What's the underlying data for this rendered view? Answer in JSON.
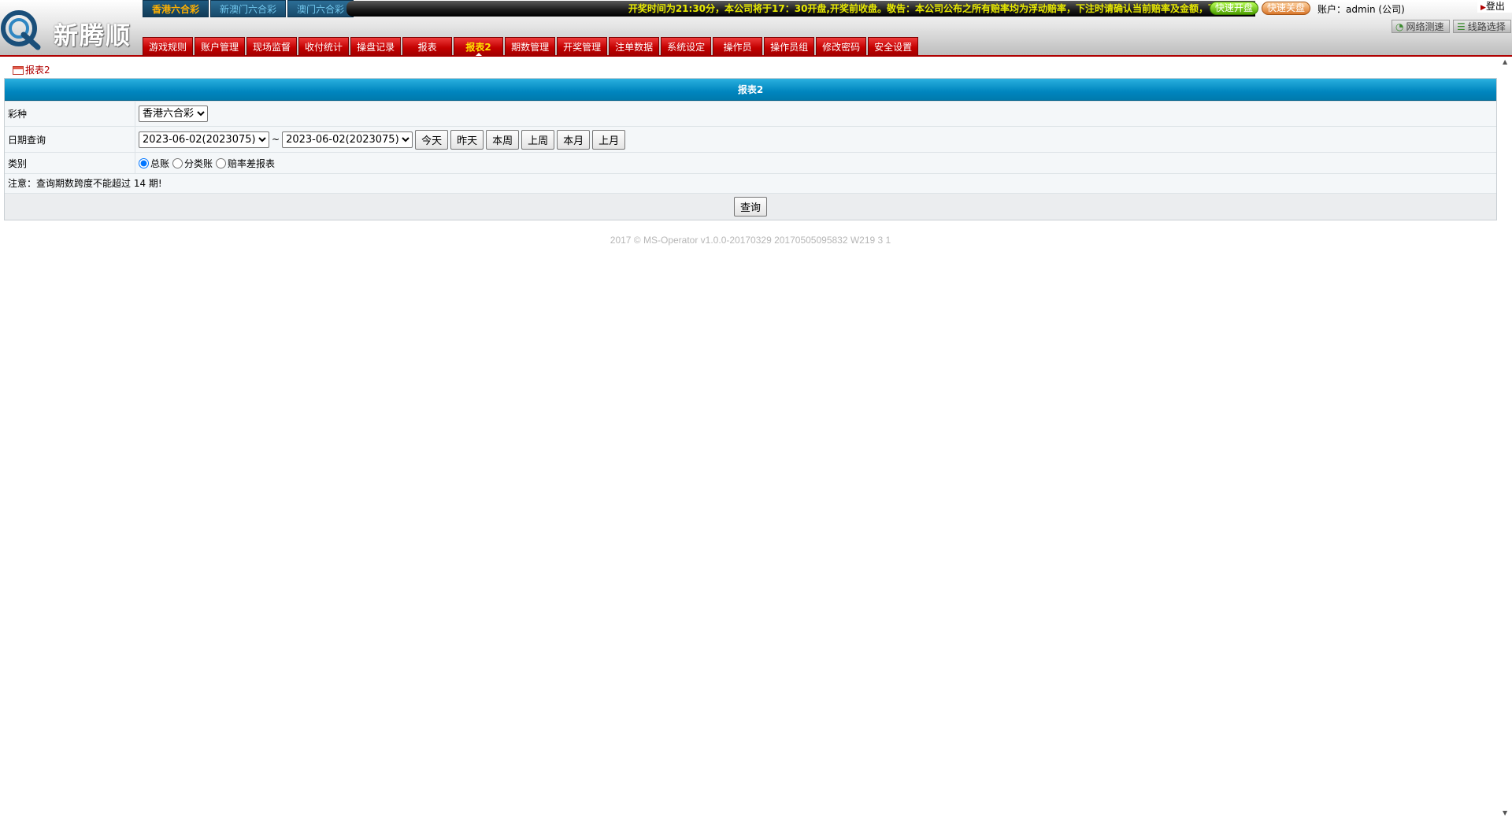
{
  "brand": {
    "name": "新腾顺",
    "logo_icon": "q-logo-icon"
  },
  "lottery_tabs": [
    {
      "label": "香港六合彩",
      "active": true
    },
    {
      "label": "新澳门六合彩",
      "active": false
    },
    {
      "label": "澳门六合彩",
      "active": false
    }
  ],
  "ticker": {
    "text": "开奖时间为21:30分，本公司将于17：30开盘,开奖前收盘。敬告：本公司公布之所有赔率均为浮动赔率，下注时请确认当前赔率及金额，下注确认后"
  },
  "header": {
    "quick_open": "快速开盘",
    "quick_close": "快速关盘",
    "account": "账户：admin (公司)",
    "logout": "登出",
    "speed_test": "网络测速",
    "route_select": "线路选择"
  },
  "nav": [
    {
      "label": "游戏规则",
      "active": false
    },
    {
      "label": "账户管理",
      "active": false
    },
    {
      "label": "现场监督",
      "active": false
    },
    {
      "label": "收付统计",
      "active": false
    },
    {
      "label": "操盘记录",
      "active": false
    },
    {
      "label": "报表",
      "active": false
    },
    {
      "label": "报表2",
      "active": true
    },
    {
      "label": "期数管理",
      "active": false
    },
    {
      "label": "开奖管理",
      "active": false
    },
    {
      "label": "注单数据",
      "active": false
    },
    {
      "label": "系统设定",
      "active": false
    },
    {
      "label": "操作员",
      "active": false
    },
    {
      "label": "操作员组",
      "active": false
    },
    {
      "label": "修改密码",
      "active": false
    },
    {
      "label": "安全设置",
      "active": false
    }
  ],
  "breadcrumb": {
    "label": "报表2"
  },
  "form": {
    "title": "报表2",
    "lottery_label": "彩种",
    "lottery_value": "香港六合彩",
    "date_label": "日期查询",
    "date_from": "2023-06-02(2023075)",
    "date_separator": "~",
    "date_to": "2023-06-02(2023075)",
    "quick_dates": [
      "今天",
      "昨天",
      "本周",
      "上周",
      "本月",
      "上月"
    ],
    "category_label": "类别",
    "categories": [
      {
        "label": "总账",
        "checked": true
      },
      {
        "label": "分类账",
        "checked": false
      },
      {
        "label": "赔率差报表",
        "checked": false
      }
    ],
    "note": "注意：查询期数跨度不能超过 14 期!",
    "submit": "查询"
  },
  "footer": {
    "text": "2017 © MS-Operator v1.0.0-20170329 20170505095832 W219 3 1"
  },
  "colors": {
    "nav_red": "#c30000",
    "panel_blue": "#0086bf",
    "ticker_yellow": "#e7e900",
    "tab_active": "#ffb000"
  }
}
